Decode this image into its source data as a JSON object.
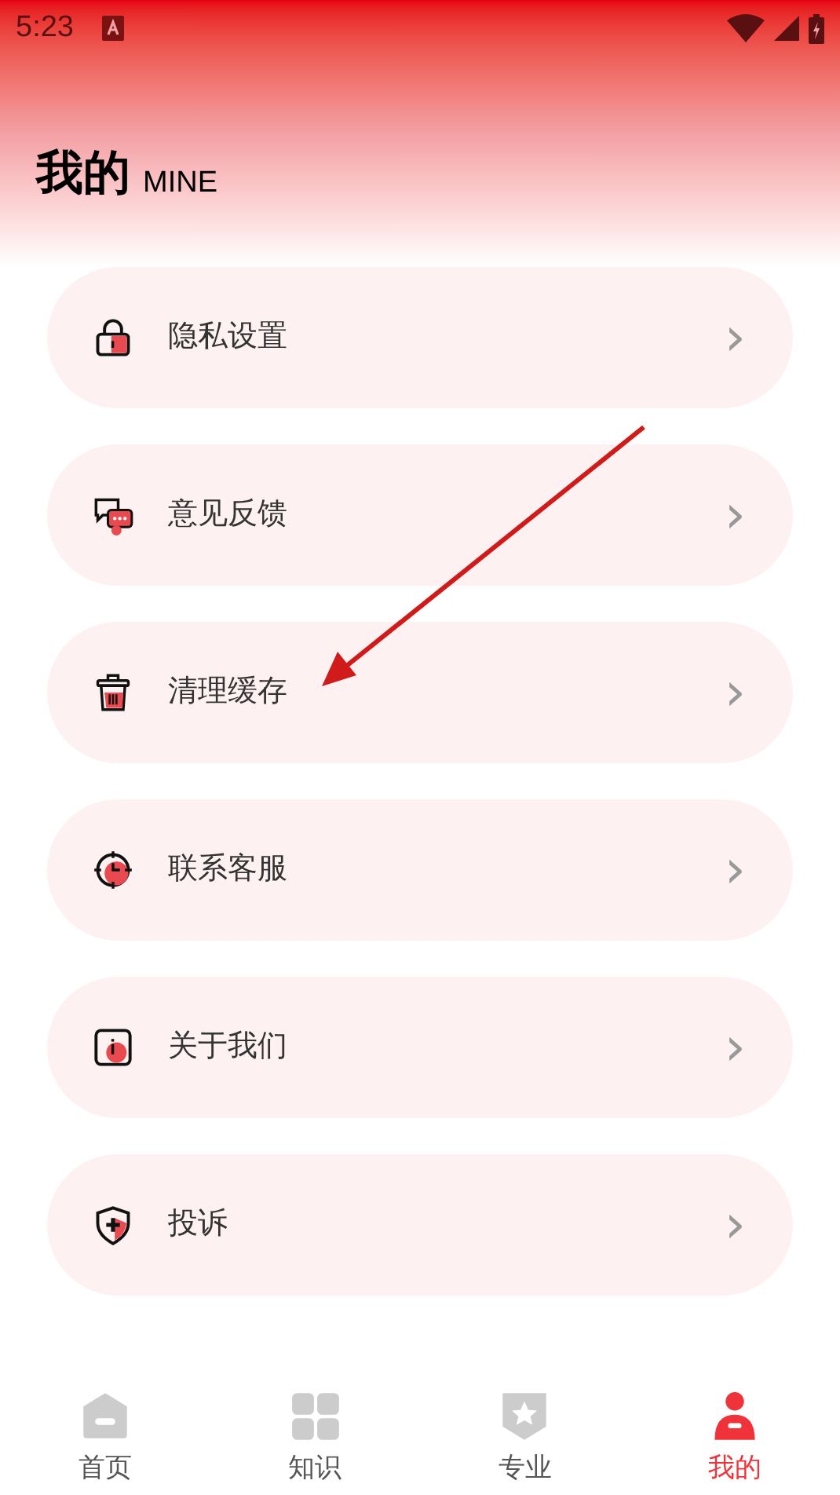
{
  "status_bar": {
    "time": "5:23"
  },
  "header": {
    "title": "我的",
    "subtitle": "MINE"
  },
  "menu": [
    {
      "label": "隐私设置",
      "chevron": "›"
    },
    {
      "label": "意见反馈",
      "chevron": "›"
    },
    {
      "label": "清理缓存",
      "chevron": "›"
    },
    {
      "label": "联系客服",
      "chevron": "›"
    },
    {
      "label": "关于我们",
      "chevron": "›"
    },
    {
      "label": "投诉",
      "chevron": "›"
    }
  ],
  "bottom_nav": [
    {
      "label": "首页",
      "selected": false
    },
    {
      "label": "知识",
      "selected": false
    },
    {
      "label": "专业",
      "selected": false
    },
    {
      "label": "我的",
      "selected": true
    }
  ]
}
